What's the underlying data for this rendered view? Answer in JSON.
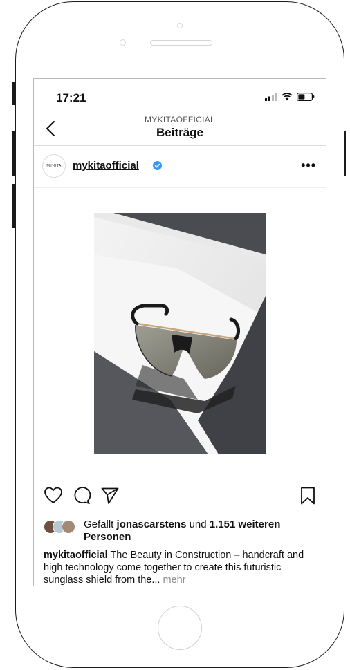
{
  "status_bar": {
    "time": "17:21"
  },
  "nav": {
    "subtitle": "MYKITAOFFICIAL",
    "title": "Beiträge"
  },
  "post": {
    "avatar_text": "MYKITA",
    "username": "mykitaofficial",
    "more_label": "•••",
    "likes": {
      "prefix": "Gefällt ",
      "liker": "jonascarstens",
      "middle": " und ",
      "count": "1.151 weiteren Personen"
    },
    "caption": {
      "user": "mykitaofficial",
      "text": " The Beauty in Construction – handcraft and high technology come together to create this futuristic sunglass shield from the... ",
      "more": "mehr"
    }
  },
  "icons": {
    "back": "chevron-left-icon",
    "verified": "verified-badge-icon",
    "like": "heart-icon",
    "comment": "comment-bubble-icon",
    "share": "paper-plane-icon",
    "save": "bookmark-icon"
  },
  "colors": {
    "verified_blue": "#3897f0",
    "text": "#111111",
    "muted": "#8e8e8e",
    "divider": "#dbdbdb"
  }
}
